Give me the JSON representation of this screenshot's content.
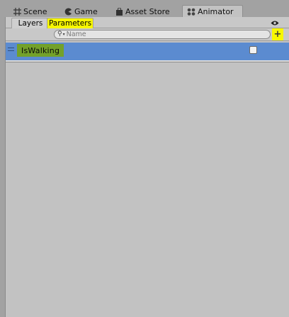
{
  "tabs": [
    {
      "label": "Scene",
      "icon": "grid-icon"
    },
    {
      "label": "Game",
      "icon": "pacman-icon"
    },
    {
      "label": "Asset Store",
      "icon": "shopping-bag-icon"
    },
    {
      "label": "Animator",
      "icon": "animator-icon",
      "active": true
    }
  ],
  "panel_tabs": {
    "layers": "Layers",
    "parameters": "Parameters"
  },
  "search": {
    "placeholder": "Name"
  },
  "add_button": {
    "label": "+",
    "icon": "plus-icon"
  },
  "eye_icon": "eye-icon",
  "parameters": [
    {
      "name": "IsWalking",
      "type": "bool",
      "checked": false
    }
  ],
  "colors": {
    "highlight": "#f7f700",
    "selected_row": "#5b8bd0",
    "name_highlight": "#73a12a"
  }
}
